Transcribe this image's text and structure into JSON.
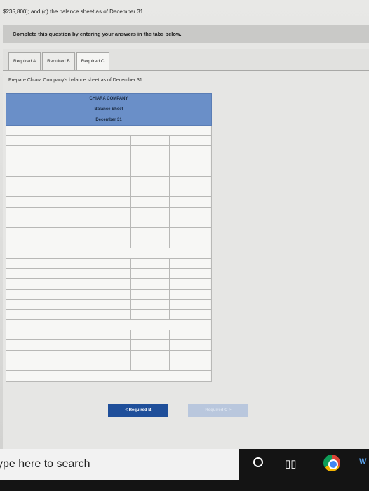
{
  "header": {
    "problem_text": "$235,800]; and (c) the balance sheet as of December 31."
  },
  "instruction": {
    "text": "Complete this question by entering your answers in the tabs below."
  },
  "tabs": [
    {
      "label": "Required A",
      "active": false
    },
    {
      "label": "Required B",
      "active": false
    },
    {
      "label": "Required C",
      "active": true
    }
  ],
  "main": {
    "prompt": "Prepare Chiara Company's balance sheet as of December 31.",
    "sheet": {
      "company": "CHIARA COMPANY",
      "title": "Balance Sheet",
      "date": "December 31"
    }
  },
  "nav": {
    "prev_label": "< Required B",
    "next_label": "Required C >"
  },
  "taskbar": {
    "search_placeholder": "ype here to search",
    "icons": [
      "cortana-icon",
      "task-view-icon",
      "chrome-icon"
    ],
    "partial_app_label": "W"
  }
}
